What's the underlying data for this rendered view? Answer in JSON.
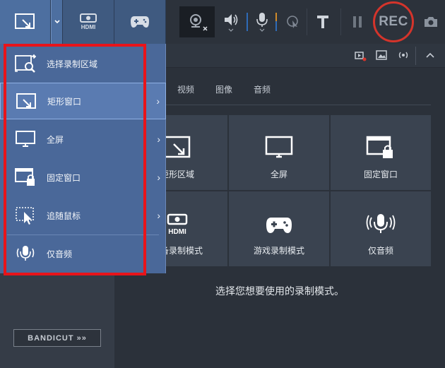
{
  "toolbar": {
    "modes": [
      "screen-mode",
      "hdmi-mode",
      "game-mode"
    ],
    "hdmi_text": "HDMI",
    "rec_label": "REC"
  },
  "menu": {
    "items": [
      {
        "label": "选择录制区域",
        "icon": "select-area-icon",
        "has_submenu": false
      },
      {
        "label": "矩形窗口",
        "icon": "rectangle-window-icon",
        "has_submenu": true
      },
      {
        "label": "全屏",
        "icon": "monitor-icon",
        "has_submenu": true
      },
      {
        "label": "固定窗口",
        "icon": "locked-window-icon",
        "has_submenu": true
      },
      {
        "label": "追随鼠标",
        "icon": "follow-mouse-icon",
        "has_submenu": true
      },
      {
        "label": "仅音频",
        "icon": "microphone-icon",
        "has_submenu": false
      }
    ],
    "chevron": "›"
  },
  "tabs": [
    "视频",
    "图像",
    "音频"
  ],
  "modes_grid": [
    {
      "label": "矩形区域",
      "icon": "rectangle-window-icon"
    },
    {
      "label": "全屏",
      "icon": "monitor-icon"
    },
    {
      "label": "固定窗口",
      "icon": "locked-window-icon"
    },
    {
      "label": "设备录制模式",
      "icon": "hdmi-icon"
    },
    {
      "label": "游戏录制模式",
      "icon": "gamepad-icon"
    },
    {
      "label": "仅音频",
      "icon": "microphone-icon"
    }
  ],
  "hint": "选择您想要使用的录制模式。",
  "bandicut": "BANDICUT",
  "colors": {
    "accent": "#4a6899",
    "highlight": "#e8141a",
    "rec": "#d4342b"
  }
}
